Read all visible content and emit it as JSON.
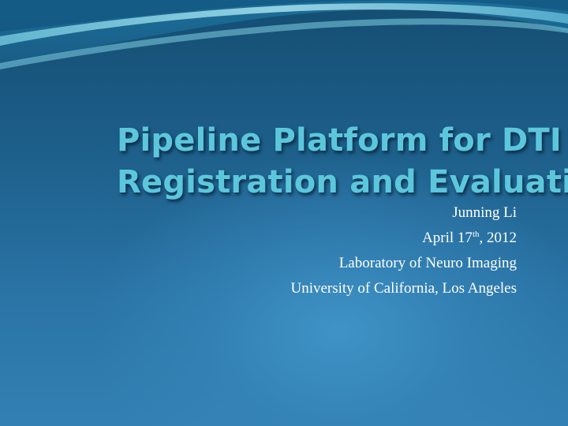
{
  "slide": {
    "title_line1": "Pipeline Platform for DTI",
    "title_line2": "Registration and Evaluation",
    "author": "Junning Li",
    "date_prefix": "April 17",
    "date_suffix": "th",
    "date_year": ", 2012",
    "lab": "Laboratory of Neuro Imaging",
    "university": "University of California, Los Angeles"
  },
  "colors": {
    "title": "#5cc7dc",
    "background_top": "#154d72",
    "background_glow": "#3f93c6",
    "subtitle": "#ffffff"
  }
}
